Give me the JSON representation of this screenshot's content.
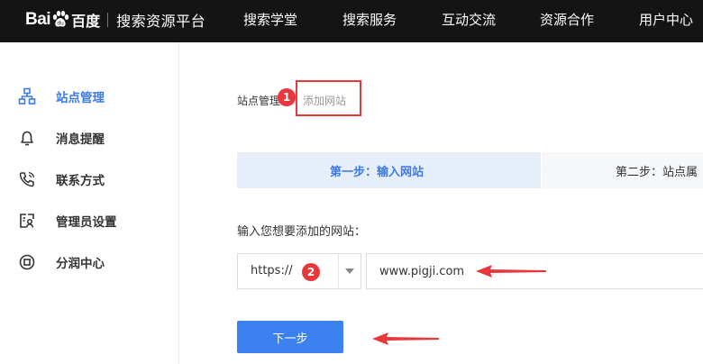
{
  "header": {
    "logo_bai": "Bai",
    "logo_du": "百度",
    "logo_subtitle": "搜索资源平台",
    "nav": [
      "搜索学堂",
      "搜索服务",
      "互动交流",
      "资源合作",
      "用户中心"
    ]
  },
  "sidebar": {
    "items": [
      {
        "label": "站点管理",
        "icon": "sitemap-icon",
        "active": true
      },
      {
        "label": "消息提醒",
        "icon": "bell-icon",
        "active": false
      },
      {
        "label": "联系方式",
        "icon": "phone-icon",
        "active": false
      },
      {
        "label": "管理员设置",
        "icon": "admin-card-icon",
        "active": false
      },
      {
        "label": "分润中心",
        "icon": "coin-icon",
        "active": false
      }
    ]
  },
  "breadcrumb": {
    "parent": "站点管理",
    "current": "添加网站"
  },
  "steps": {
    "step1": "第一步：输入网站",
    "step2": "第二步：站点属"
  },
  "form": {
    "prompt": "输入您想要添加的网站：",
    "protocol_value": "https://",
    "url_value": "www.pigji.com",
    "next_label": "下一步"
  },
  "annotations": {
    "badge1": "1",
    "badge2": "2"
  },
  "colors": {
    "header_bg": "#141414",
    "accent": "#3e7ae8",
    "button": "#3b82f0",
    "annotation_red": "#e8383d",
    "step_active_bg": "#e6eefa"
  }
}
